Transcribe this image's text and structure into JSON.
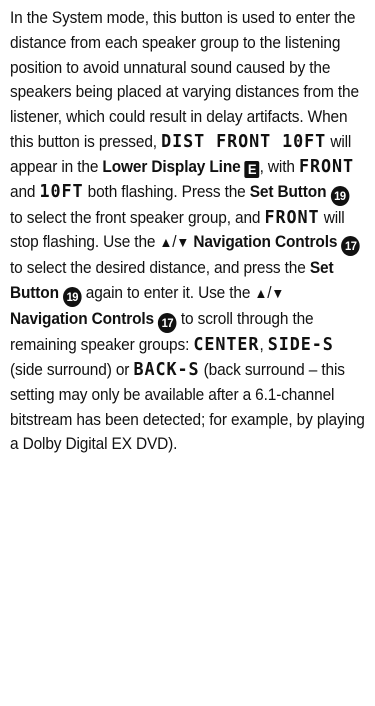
{
  "text": {
    "t1": "In the System mode, this button is used to enter the distance from each speaker group to the listening position to avoid unnatural sound caused by the speakers being placed at varying distances from the listener, which could result in delay artifacts. When this button is pressed, ",
    "lcd_dist": "DIST FRONT 10FT",
    "t2": " will appear in the ",
    "lower_display_line": "Lower Display Line",
    "badge_e": "E",
    "t3": ", with ",
    "lcd_front": "FRONT",
    "t4": " and ",
    "lcd_10ft": "10FT",
    "t5": " both flashing. Press the ",
    "set_button_1": "Set Button",
    "badge_19a": "19",
    "t6": " to select the front speaker group, and ",
    "lcd_front2": "FRONT",
    "t7": " will stop flashing. Use the ",
    "up_arrow": "▲",
    "slash": "/",
    "down_arrow": "▼",
    "navigation_controls_1": "Navigation Controls",
    "badge_17a": "17",
    "t8": " to select the desired distance, and press the ",
    "set_button_2": "Set Button",
    "badge_19b": "19",
    "t9": " again to enter it. Use the ",
    "navigation_controls_2": "Navigation Controls",
    "badge_17b": "17",
    "t10": " to scroll through the remaining speaker groups: ",
    "lcd_center": "CENTER",
    "t11": ", ",
    "lcd_side": "SIDE-S",
    "t12": " (side surround) or ",
    "lcd_back": "BACK-S",
    "t13": " (back surround – this setting may only be available after a 6.1-channel bitstream has been detected; for example, by playing a Dolby Digital EX DVD)."
  }
}
